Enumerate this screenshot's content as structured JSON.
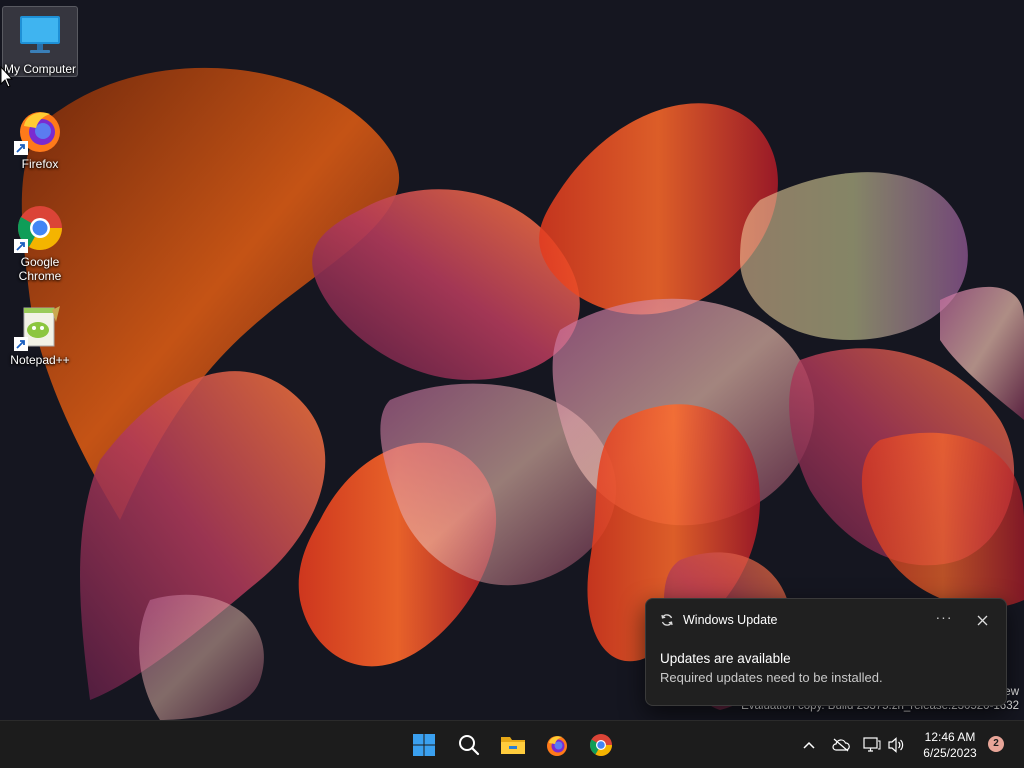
{
  "desktop": {
    "icons": [
      {
        "label": "My Computer",
        "icon": "monitor-icon",
        "selected": true
      },
      {
        "label": "Firefox",
        "icon": "firefox-icon"
      },
      {
        "label": "Google\nChrome",
        "icon": "chrome-icon"
      },
      {
        "label": "Notepad++",
        "icon": "notepadpp-icon"
      }
    ],
    "watermark_partial": "ew",
    "watermark": "Evaluation copy. Build 25375.zn_release.230520-1632"
  },
  "toast": {
    "app_name": "Windows Update",
    "app_icon": "sync-icon",
    "more_label": "···",
    "close_icon": "close-icon",
    "title": "Updates are available",
    "body": "Required updates need to be installed."
  },
  "taskbar": {
    "pinned": [
      {
        "name": "start-button",
        "icon": "windows-logo-icon"
      },
      {
        "name": "search-button",
        "icon": "search-icon"
      },
      {
        "name": "file-explorer-button",
        "icon": "folder-icon"
      },
      {
        "name": "firefox-taskbar-button",
        "icon": "firefox-icon"
      },
      {
        "name": "chrome-taskbar-button",
        "icon": "chrome-icon"
      }
    ],
    "tray": {
      "chevron_icon": "chevron-up-icon",
      "network_icon": "cloud-off-icon",
      "display_icon": "monitor-icon",
      "volume_icon": "speaker-icon"
    },
    "time": "12:46 AM",
    "date": "6/25/2023",
    "notification_count": "2"
  },
  "colors": {
    "accent": "#0078d4",
    "taskbar": "#1c1c1c",
    "toast_bg": "#202020",
    "badge": "#e8a598"
  }
}
